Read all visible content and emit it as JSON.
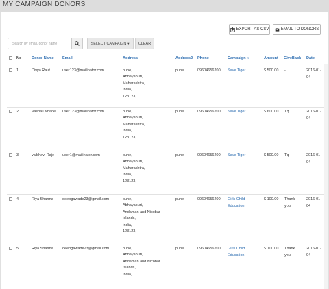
{
  "page": {
    "title": "MY CAMPAIGN DONORS"
  },
  "actions": {
    "export_label": "EXPORT AS CSV",
    "email_label": "EMAIL TO DONORS"
  },
  "filters": {
    "search_placeholder": "Search by email, donor name",
    "campaign_label": "SELECT CAMPAIGN",
    "clear_label": "CLEAR"
  },
  "table": {
    "headers": {
      "no": "No",
      "donor": "Donor Name",
      "email": "Email",
      "address": "Address",
      "address2": "Address2",
      "phone": "Phone",
      "campaign": "Campaign",
      "amount": "Amount",
      "giveback": "GiveBack",
      "date": "Date"
    },
    "rows": [
      {
        "no": "1",
        "donor": "Divya Raut",
        "email": "user123@mailinator.com",
        "address_lines": [
          "pune,",
          "Abhayapuri,",
          "Maharashtra,",
          "India,",
          "123123,"
        ],
        "address2": "pune",
        "phone": "09604656200",
        "campaign": "Save Tiger",
        "amount": "$ 500.00",
        "giveback_lines": [
          "-"
        ],
        "date_lines": [
          "2016-01-",
          "04"
        ]
      },
      {
        "no": "2",
        "donor": "Vashali Khade",
        "email": "user123@mailinator.com",
        "address_lines": [
          "pune,",
          "Abhayapuri,",
          "Maharashtra,",
          "India,",
          "123123,"
        ],
        "address2": "pune",
        "phone": "09604656200",
        "campaign": "Save Tiger",
        "amount": "$ 600.00",
        "giveback_lines": [
          "Tq"
        ],
        "date_lines": [
          "2016-01-",
          "04"
        ]
      },
      {
        "no": "3",
        "donor": "vaibhavi Raje",
        "email": "user1@mailinator.com",
        "address_lines": [
          "pune,",
          "Abhayapuri,",
          "Maharashtra,",
          "India,",
          "123123,"
        ],
        "address2": "pune",
        "phone": "09604656200",
        "campaign": "Save Tiger",
        "amount": "$ 500.00",
        "giveback_lines": [
          "Tq"
        ],
        "date_lines": [
          "2016-01-",
          "04"
        ]
      },
      {
        "no": "4",
        "donor": "Riya Sharma",
        "email": "deepgawade23@gmail.com",
        "address_lines": [
          "pune,",
          "Abhayapuri,",
          "Andaman and Nicobar",
          "Islands,",
          "India,",
          "123123,"
        ],
        "address2": "pune",
        "phone": "09604656200",
        "campaign_lines": [
          "Girls Child",
          "Education"
        ],
        "amount": "$ 100.00",
        "giveback_lines": [
          "Thank",
          "you"
        ],
        "date_lines": [
          "2016-01-",
          "04"
        ]
      },
      {
        "no": "5",
        "donor": "Riya Sharma",
        "email": "deepgawade23@gmail.com",
        "address_lines": [
          "pune,",
          "Abhayapuri,",
          "Andaman and Nicobar",
          "Islands,",
          "India,"
        ],
        "address2": "pune",
        "phone": "09604656200",
        "campaign_lines": [
          "Girls Child",
          "Education"
        ],
        "amount": "$ 100.00",
        "giveback_lines": [
          "Thank",
          "you"
        ],
        "date_lines": [
          "2016-01-",
          "04"
        ]
      }
    ]
  },
  "colors": {
    "link": "#2b6cb0",
    "background": "#dddddd",
    "panel": "#ffffff"
  },
  "icons": {
    "export": "export-icon",
    "email": "envelope-icon",
    "search": "search-icon",
    "caret": "caret-down-icon"
  }
}
